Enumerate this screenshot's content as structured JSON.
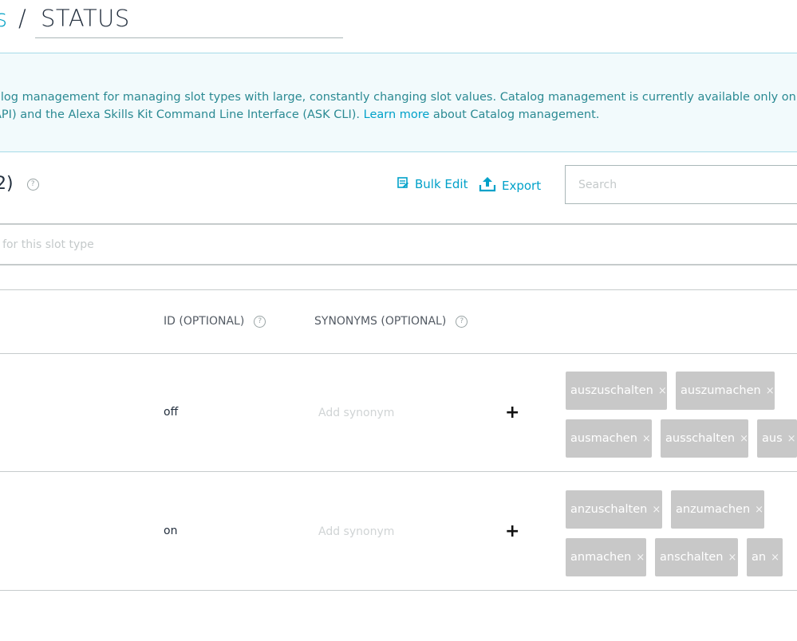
{
  "breadcrumb": {
    "link": "s",
    "separator": "/",
    "title": "STATUS"
  },
  "banner": {
    "line1": "alog management for managing slot types with large, constantly changing slot values. Catalog management is currently available only on Alexa Skills",
    "line2_before": "API) and the Alexa Skills Kit Command Line Interface (ASK CLI). ",
    "learn_more": "Learn more",
    "line2_after": " about Catalog management."
  },
  "toolbar": {
    "count": "2)",
    "help": "?",
    "bulk_edit_label": "Bulk Edit",
    "export_label": "Export",
    "search_placeholder": "Search"
  },
  "new_value": {
    "placeholder": "e for this slot type"
  },
  "table": {
    "headers": {
      "id": "ID (OPTIONAL)",
      "synonyms": "SYNONYMS (OPTIONAL)"
    },
    "rows": [
      {
        "id": "off",
        "synonym_placeholder": "Add synonym",
        "add": "+",
        "synonyms": [
          "auszuschalten",
          "auszumachen",
          "ausmachen",
          "ausschalten",
          "aus"
        ]
      },
      {
        "id": "on",
        "synonym_placeholder": "Add synonym",
        "add": "+",
        "synonyms": [
          "anzuschalten",
          "anzumachen",
          "anmachen",
          "anschalten",
          "an"
        ]
      }
    ],
    "remove_glyph": "×"
  },
  "icons": {
    "bulk_edit": "bulk-edit-icon",
    "export": "upload-icon",
    "help": "help-icon"
  },
  "colors": {
    "accent": "#00a1c9",
    "banner_bg": "#f2fafc",
    "chip_bg": "#c8c8c8"
  }
}
